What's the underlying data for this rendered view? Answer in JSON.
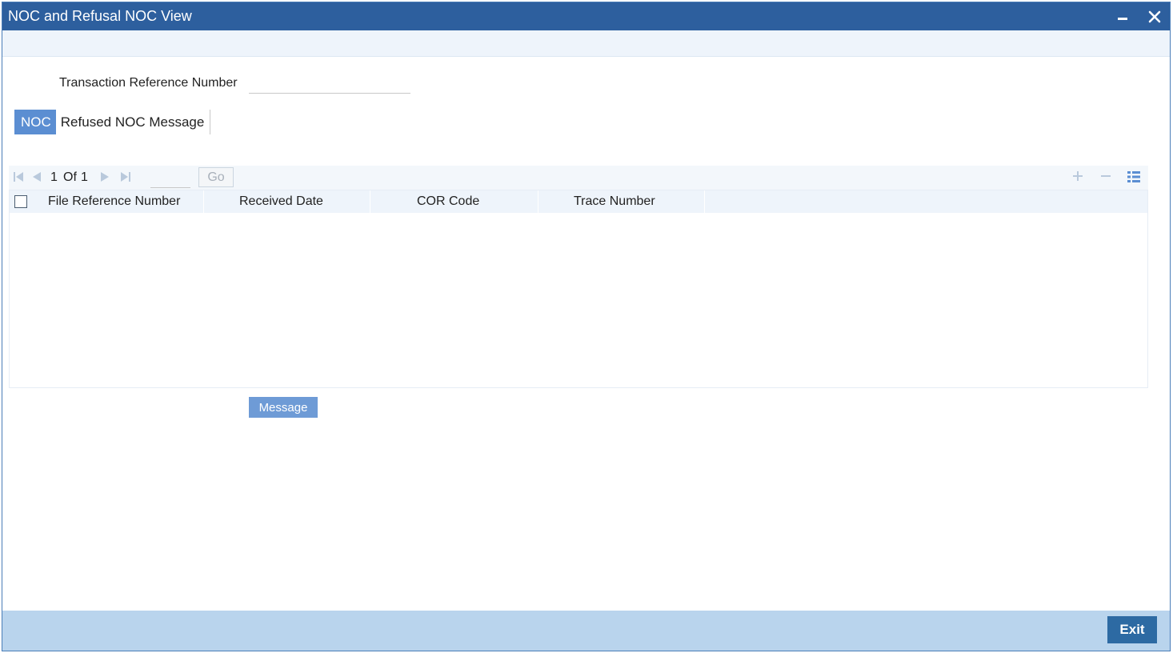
{
  "window": {
    "title": "NOC and Refusal NOC View",
    "minimize_icon": "minimize-icon",
    "close_icon": "close-icon"
  },
  "form": {
    "transaction_reference_label": "Transaction Reference Number",
    "transaction_reference_value": ""
  },
  "tabs": [
    {
      "label": "NOC",
      "active": true
    },
    {
      "label": "Refused NOC Message",
      "active": false
    }
  ],
  "pagination": {
    "current": "1",
    "of_label": "Of",
    "total": "1",
    "go_label": "Go",
    "page_input_value": ""
  },
  "grid": {
    "columns": [
      "File Reference Number",
      "Received Date",
      "COR Code",
      "Trace Number"
    ],
    "rows": []
  },
  "buttons": {
    "message_label": "Message",
    "exit_label": "Exit"
  },
  "colors": {
    "title_bar": "#2d5f9e",
    "tab_active": "#5b8ed2",
    "footer": "#b9d4ed",
    "exit_button": "#2d6aa3",
    "message_button": "#6e9bd6"
  }
}
